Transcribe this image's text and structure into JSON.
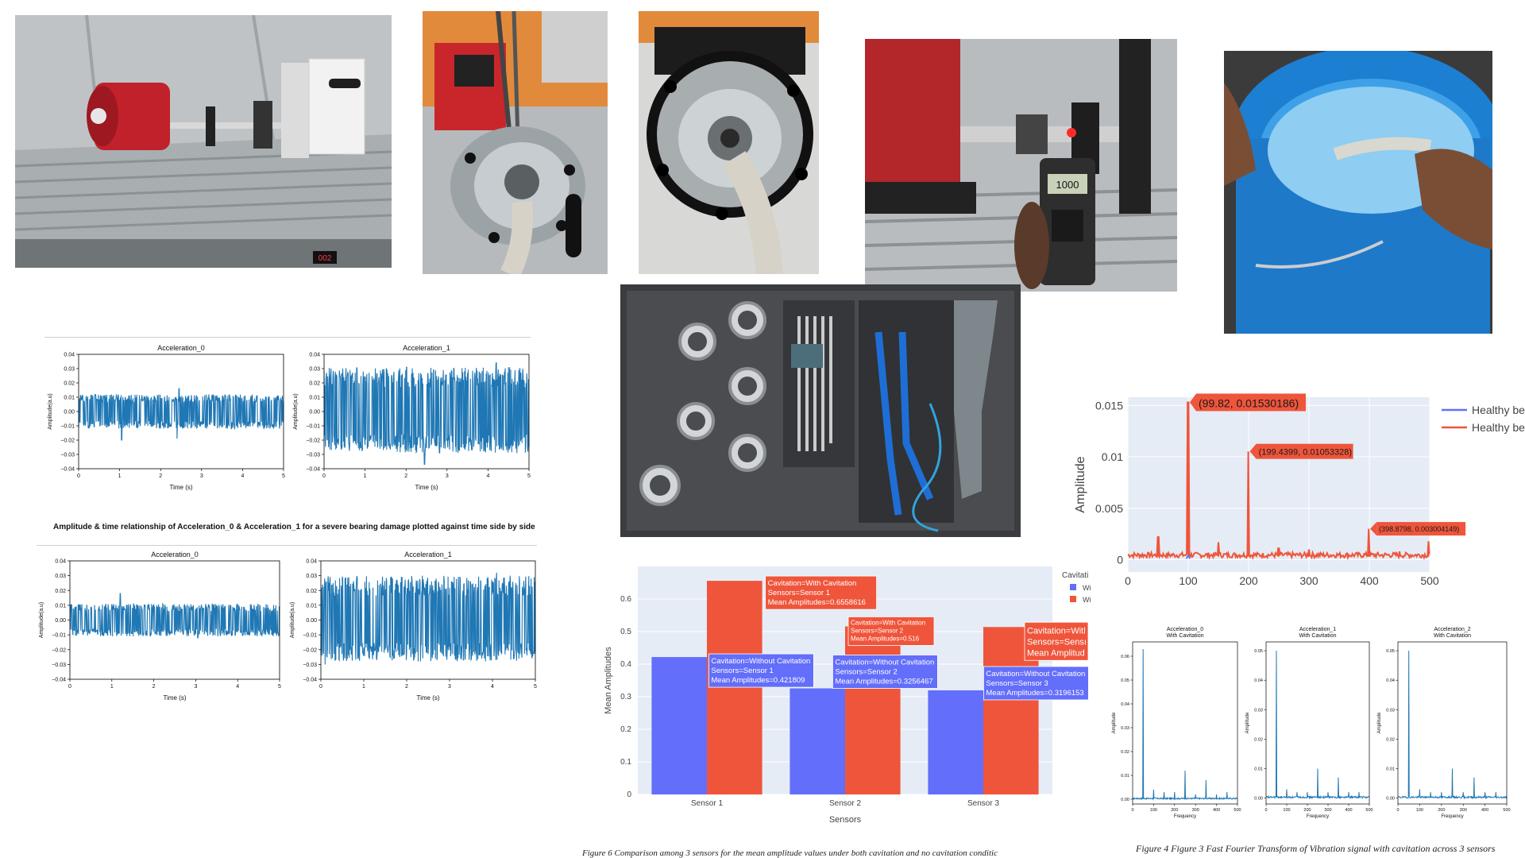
{
  "icons": {
    "photo_motor_rig": "motor-rig-photo",
    "photo_pump_closeup": "pump-closeup-photo",
    "photo_pump_front": "pump-front-photo",
    "photo_tachometer": "tachometer-photo",
    "photo_bucket": "water-bucket-photo",
    "photo_tools": "bearings-and-tools-photo"
  },
  "photos": {
    "motor_rig_readout": "002",
    "tachometer_readout": "1000"
  },
  "colors": {
    "signal_blue": "#1f77b4",
    "without_cavitation": "#636efa",
    "with_cavitation": "#ef553b",
    "plotly_bg": "#e5ecf6"
  },
  "time_heading": "Amplitude & time relationship of Acceleration_0 & Acceleration_1 for a severe bearing damage plotted against time side by side",
  "captions": {
    "fig6": "Figure 6 Comparison among 3 sensors for the mean amplitude values under both cavitation and no cavitation conditic",
    "fig4": "Figure 4 Figure 3 Fast Fourier Transform of Vibration signal with cavitation across 3 sensors"
  },
  "chart_data": [
    {
      "id": "time_top_left",
      "type": "line",
      "title": "Acceleration_0",
      "xlabel": "Time (s)",
      "ylabel": "Amplitude(a.u)",
      "xlim": [
        0,
        5
      ],
      "ylim": [
        -0.04,
        0.04
      ],
      "xticks": [
        "0",
        "1",
        "2",
        "3",
        "4",
        "5"
      ],
      "yticks": [
        "0.04",
        "0.03",
        "0.02",
        "0.01",
        "0.00",
        "−0.01",
        "−0.02",
        "−0.03",
        "−0.04"
      ],
      "band": {
        "upper": 0.012,
        "lower": -0.012,
        "spikes": [
          [
            1.05,
            -0.02
          ],
          [
            2.4,
            -0.019
          ],
          [
            2.45,
            0.016
          ]
        ]
      },
      "series": [
        {
          "color": "#1f77b4"
        }
      ]
    },
    {
      "id": "time_top_right",
      "type": "line",
      "title": "Acceleration_1",
      "xlabel": "Time (s)",
      "ylabel": "Amplitude(a.u)",
      "xlim": [
        0,
        5
      ],
      "ylim": [
        -0.04,
        0.04
      ],
      "xticks": [
        "0",
        "1",
        "2",
        "3",
        "4",
        "5"
      ],
      "yticks": [
        "0.04",
        "0.03",
        "0.02",
        "0.01",
        "0.00",
        "−0.01",
        "−0.02",
        "−0.03",
        "−0.04"
      ],
      "band": {
        "upper": 0.031,
        "lower": -0.029,
        "spikes": [
          [
            2.45,
            -0.037
          ],
          [
            4.2,
            0.034
          ]
        ]
      },
      "series": [
        {
          "color": "#1f77b4"
        }
      ]
    },
    {
      "id": "time_bottom_left",
      "type": "line",
      "title": "Acceleration_0",
      "xlabel": "Time (s)",
      "ylabel": "Amplitude(a.u)",
      "xlim": [
        0,
        5
      ],
      "ylim": [
        -0.04,
        0.04
      ],
      "xticks": [
        "0",
        "1",
        "2",
        "3",
        "4",
        "5"
      ],
      "yticks": [
        "0.04",
        "0.03",
        "0.02",
        "0.01",
        "0.00",
        "−0.01",
        "−0.02",
        "−0.03",
        "−0.04"
      ],
      "band": {
        "upper": 0.011,
        "lower": -0.011,
        "spikes": [
          [
            1.2,
            0.018
          ],
          [
            3.05,
            -0.012
          ]
        ]
      },
      "series": [
        {
          "color": "#1f77b4"
        }
      ]
    },
    {
      "id": "time_bottom_right",
      "type": "line",
      "title": "Acceleration_1",
      "xlabel": "Time (s)",
      "ylabel": "Amplitude(a.u)",
      "xlim": [
        0,
        5
      ],
      "ylim": [
        -0.04,
        0.04
      ],
      "xticks": [
        "0",
        "1",
        "2",
        "3",
        "4",
        "5"
      ],
      "yticks": [
        "0.04",
        "0.03",
        "0.02",
        "0.01",
        "0.00",
        "−0.01",
        "−0.02",
        "−0.03",
        "−0.04"
      ],
      "band": {
        "upper": 0.03,
        "lower": -0.028,
        "spikes": [
          [
            0.1,
            -0.03
          ],
          [
            4.1,
            0.032
          ]
        ]
      },
      "series": [
        {
          "color": "#1f77b4"
        }
      ]
    },
    {
      "id": "mean_amplitudes",
      "type": "bar",
      "xlabel": "Sensors",
      "ylabel": "Mean Amplitudes",
      "ylim": [
        0,
        0.7
      ],
      "yticks": [
        "0",
        "0.1",
        "0.2",
        "0.3",
        "0.4",
        "0.5",
        "0.6"
      ],
      "categories": [
        "Sensor 1",
        "Sensor 2",
        "Sensor 3"
      ],
      "legend_title": "Cavitati",
      "legend_labels": [
        "Wi",
        "Wi"
      ],
      "series": [
        {
          "name": "Without Cavitation",
          "color": "#636efa",
          "values": [
            0.421809,
            0.3256467,
            0.3196153
          ]
        },
        {
          "name": "With Cavitation",
          "color": "#ef553b",
          "values": [
            0.6558616,
            0.516,
            0.514
          ]
        }
      ],
      "hovers": [
        {
          "sensor": 0,
          "series": 1,
          "lines": [
            "Cavitation=With Cavitation",
            "Sensors=Sensor 1",
            "Mean Amplitudes=0.6558616"
          ]
        },
        {
          "sensor": 0,
          "series": 0,
          "lines": [
            "Cavitation=Without Cavitation",
            "Sensors=Sensor 1",
            "Mean Amplitudes=0.421809"
          ]
        },
        {
          "sensor": 1,
          "series": 1,
          "lines": [
            "Cavitation=With Cavitation",
            "Sensors=Sensor 2",
            "Mean Amplitudes=0.516"
          ]
        },
        {
          "sensor": 1,
          "series": 0,
          "lines": [
            "Cavitation=Without Cavitation",
            "Sensors=Sensor 2",
            "Mean Amplitudes=0.3256467"
          ]
        },
        {
          "sensor": 2,
          "series": 1,
          "lines": [
            "Cavitation=Witl",
            "Sensors=Sensı",
            "Mean Amplitud"
          ]
        },
        {
          "sensor": 2,
          "series": 0,
          "lines": [
            "Cavitation=Without Cavitation",
            "Sensors=Sensor 3",
            "Mean Amplitudes=0.3196153"
          ]
        }
      ]
    },
    {
      "id": "fft_comparison",
      "type": "line",
      "ylabel": "Amplitude",
      "xlim": [
        0,
        500
      ],
      "ylim": [
        -0.0012,
        0.0158
      ],
      "xticks": [
        "0",
        "100",
        "200",
        "300",
        "400",
        "500"
      ],
      "yticks": [
        "0",
        "0.005",
        "0.01",
        "0.015"
      ],
      "legend_labels": [
        "Healthy be",
        "Healthy be"
      ],
      "series": [
        {
          "color": "#ef553b",
          "peaks": [
            [
              50,
              0.0022
            ],
            [
              100,
              0.01530186
            ],
            [
              150,
              0.0017
            ],
            [
              199.4399,
              0.01053328
            ],
            [
              250,
              0.0011
            ],
            [
              300,
              0.001
            ],
            [
              398.8798,
              0.003004149
            ],
            [
              450,
              0.0008
            ],
            [
              498,
              0.0018
            ]
          ]
        },
        {
          "color": "#636efa",
          "peaks": [
            [
              100,
              0.0004
            ]
          ]
        }
      ],
      "annotations": [
        "(99.82, 0.01530186)",
        "(199.4399, 0.01053328)",
        "(398.8798, 0.003004149)"
      ]
    },
    {
      "id": "fft_acc0",
      "type": "line",
      "title": [
        "Acceleration_0",
        "With Cavitation"
      ],
      "xlabel": "Frequency",
      "ylabel": "Amplitude",
      "xlim": [
        0,
        500
      ],
      "ylim": [
        -0.002,
        0.066
      ],
      "xticks": [
        "0",
        "100",
        "200",
        "300",
        "400",
        "500"
      ],
      "yticks": [
        "0.00",
        "0.01",
        "0.02",
        "0.03",
        "0.04",
        "0.05",
        "0.06"
      ],
      "series": [
        {
          "color": "#1f77b4",
          "peaks": [
            [
              50,
              0.063
            ],
            [
              100,
              0.004
            ],
            [
              150,
              0.003
            ],
            [
              200,
              0.003
            ],
            [
              250,
              0.012
            ],
            [
              300,
              0.002
            ],
            [
              350,
              0.008
            ],
            [
              400,
              0.002
            ],
            [
              450,
              0.003
            ]
          ]
        }
      ]
    },
    {
      "id": "fft_acc1",
      "type": "line",
      "title": [
        "Acceleration_1",
        "With Cavitation"
      ],
      "xlabel": "Frequency",
      "ylabel": "Amplitude",
      "xlim": [
        0,
        500
      ],
      "ylim": [
        -0.002,
        0.053
      ],
      "xticks": [
        "0",
        "100",
        "200",
        "300",
        "400",
        "500"
      ],
      "yticks": [
        "0.00",
        "0.01",
        "0.02",
        "0.03",
        "0.04",
        "0.05"
      ],
      "series": [
        {
          "color": "#1f77b4",
          "peaks": [
            [
              50,
              0.05
            ],
            [
              100,
              0.003
            ],
            [
              150,
              0.002
            ],
            [
              200,
              0.002
            ],
            [
              250,
              0.01
            ],
            [
              300,
              0.002
            ],
            [
              350,
              0.007
            ],
            [
              400,
              0.002
            ],
            [
              450,
              0.002
            ]
          ]
        }
      ]
    },
    {
      "id": "fft_acc2",
      "type": "line",
      "title": [
        "Acceleration_2",
        "With Cavitation"
      ],
      "xlabel": "Frequency",
      "ylabel": "Amplitude",
      "xlim": [
        0,
        500
      ],
      "ylim": [
        -0.002,
        0.053
      ],
      "xticks": [
        "0",
        "100",
        "200",
        "300",
        "400",
        "500"
      ],
      "yticks": [
        "0.00",
        "0.01",
        "0.02",
        "0.03",
        "0.04",
        "0.05"
      ],
      "series": [
        {
          "color": "#1f77b4",
          "peaks": [
            [
              50,
              0.05
            ],
            [
              100,
              0.003
            ],
            [
              150,
              0.002
            ],
            [
              200,
              0.002
            ],
            [
              250,
              0.01
            ],
            [
              300,
              0.002
            ],
            [
              350,
              0.007
            ],
            [
              400,
              0.002
            ],
            [
              450,
              0.002
            ]
          ]
        }
      ]
    }
  ]
}
